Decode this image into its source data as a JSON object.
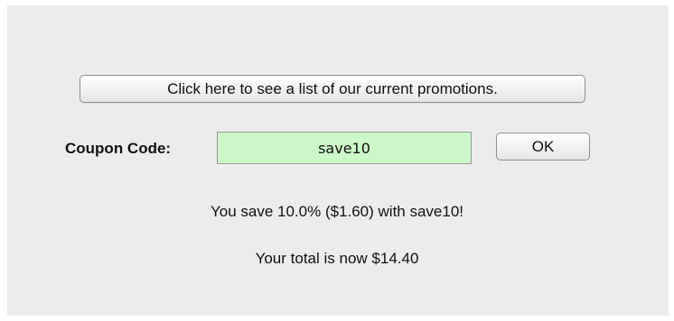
{
  "promotions_button": {
    "label": "Click here to see a list of our current promotions."
  },
  "coupon": {
    "label": "Coupon Code:",
    "value": "save10",
    "field_color": "#ccf8c9"
  },
  "ok_button": {
    "label": "OK"
  },
  "result": {
    "savings_message": "You save 10.0% ($1.60) with save10!",
    "total_message": "Your total is now $14.40"
  }
}
